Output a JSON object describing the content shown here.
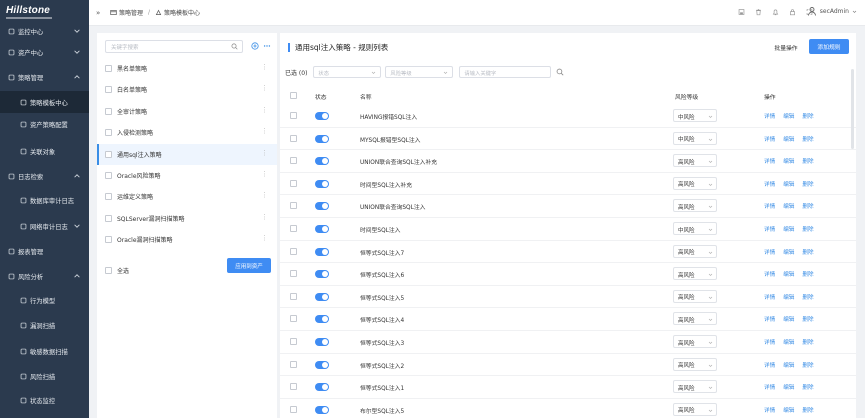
{
  "brand": {
    "logo_text": "Hillstone"
  },
  "sidebar": {
    "items": [
      {
        "label": "监控中心",
        "level": "top",
        "icon": "monitor-icon",
        "chevron": "down"
      },
      {
        "label": "资产中心",
        "level": "top",
        "icon": "server-icon",
        "chevron": "down"
      },
      {
        "label": "策略管理",
        "level": "top",
        "icon": "policy-icon",
        "chevron": "up"
      },
      {
        "label": "策略模板中心",
        "level": "sub",
        "icon": "template-icon",
        "active": true
      },
      {
        "label": "资产策略配置",
        "level": "sub",
        "icon": "config-icon"
      },
      {
        "label": "关联对象",
        "level": "sub",
        "icon": "link-icon"
      },
      {
        "label": "日志检索",
        "level": "top",
        "icon": "log-icon",
        "chevron": "up"
      },
      {
        "label": "数据库审计日志",
        "level": "sub",
        "icon": "user-icon"
      },
      {
        "label": "网络审计日志",
        "level": "sub",
        "icon": "user-icon",
        "chevron": "down"
      },
      {
        "label": "报表管理",
        "level": "top",
        "icon": "report-icon"
      },
      {
        "label": "风险分析",
        "level": "top",
        "icon": "risk-icon",
        "chevron": "up"
      },
      {
        "label": "行为模型",
        "level": "sub",
        "icon": "model-icon"
      },
      {
        "label": "漏洞扫描",
        "level": "sub",
        "icon": "scan-icon"
      },
      {
        "label": "敏感数据扫描",
        "level": "sub",
        "icon": "sensitive-icon"
      },
      {
        "label": "风险扫描",
        "level": "sub",
        "icon": "brush-icon"
      },
      {
        "label": "状态监控",
        "level": "sub",
        "icon": "status-icon"
      }
    ]
  },
  "header": {
    "collapse_glyph": "»",
    "breadcrumb": [
      "策略管理",
      "策略模板中心"
    ],
    "user_name": "secAdmin"
  },
  "policy_panel": {
    "search_placeholder": "关键字搜索",
    "policies": [
      "黑名单策略",
      "白名单策略",
      "全审计策略",
      "入侵检测策略",
      "通用sql注入策略",
      "Oracle风险策略",
      "运维定义策略",
      "SQLServer漏洞扫描策略",
      "Oracle漏洞扫描策略"
    ],
    "selected_index": 4,
    "select_all_label": "全选",
    "apply_button": "应用到资产"
  },
  "rule_panel": {
    "title": "通用sql注入策略 - 规则列表",
    "batch_button": "批量操作",
    "add_button": "添加规则",
    "selected_label": "已选 (0)",
    "status_filter_placeholder": "状态",
    "risk_filter_placeholder": "风险等级",
    "keyword_placeholder": "请输入关键字",
    "columns": {
      "status": "状态",
      "name": "名称",
      "risk": "风险等级",
      "ops": "操作"
    },
    "ops": {
      "detail": "详情",
      "edit": "编辑",
      "delete": "删除"
    },
    "rules": [
      {
        "name": "HAVING报错SQL注入",
        "risk": "中风险",
        "enabled": true
      },
      {
        "name": "MYSQL报错型SQL注入",
        "risk": "中风险",
        "enabled": true
      },
      {
        "name": "UNION联合查询SQL注入补充",
        "risk": "高风险",
        "enabled": true
      },
      {
        "name": "时间型SQL注入补充",
        "risk": "高风险",
        "enabled": true
      },
      {
        "name": "UNION联合查询SQL注入",
        "risk": "高风险",
        "enabled": true
      },
      {
        "name": "时间型SQL注入",
        "risk": "中风险",
        "enabled": true
      },
      {
        "name": "恒等式SQL注入7",
        "risk": "高风险",
        "enabled": true
      },
      {
        "name": "恒等式SQL注入6",
        "risk": "高风险",
        "enabled": true
      },
      {
        "name": "恒等式SQL注入5",
        "risk": "高风险",
        "enabled": true
      },
      {
        "name": "恒等式SQL注入4",
        "risk": "高风险",
        "enabled": true
      },
      {
        "name": "恒等式SQL注入3",
        "risk": "高风险",
        "enabled": true
      },
      {
        "name": "恒等式SQL注入2",
        "risk": "高风险",
        "enabled": true
      },
      {
        "name": "恒等式SQL注入1",
        "risk": "高风险",
        "enabled": true
      },
      {
        "name": "布尔型SQL注入5",
        "risk": "高风险",
        "enabled": true
      }
    ]
  },
  "colors": {
    "sidebar_bg": "#2b3a4e",
    "accent": "#3f8cf3",
    "link": "#3a8ee6"
  }
}
